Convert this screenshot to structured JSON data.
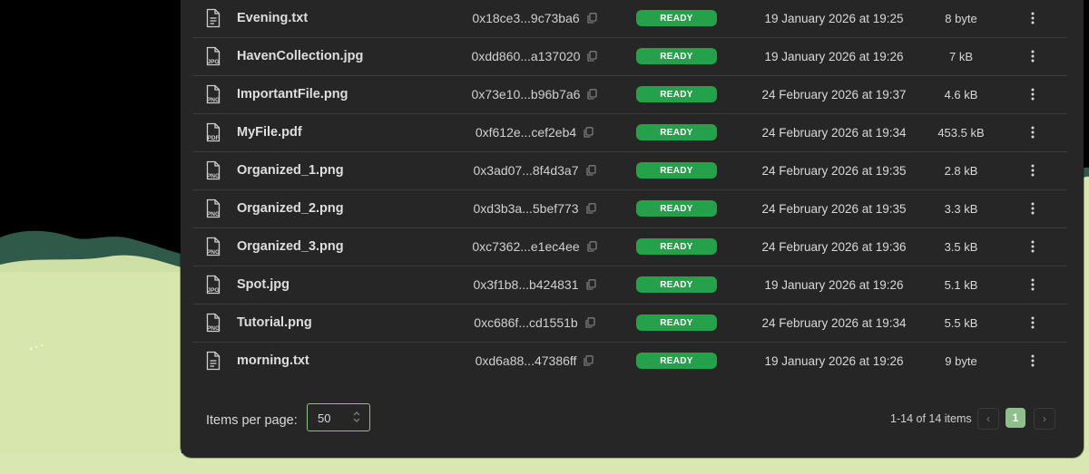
{
  "files": [
    {
      "icon": "txt-file-icon",
      "type_label": "",
      "name": "Evening.txt",
      "hash": "0x18ce3...9c73ba6",
      "status": "READY",
      "date": "19 January 2026 at 19:25",
      "size": "8 byte"
    },
    {
      "icon": "jpg-file-icon",
      "type_label": "JPG",
      "name": "HavenCollection.jpg",
      "hash": "0xdd860...a137020",
      "status": "READY",
      "date": "19 January 2026 at 19:26",
      "size": "7 kB"
    },
    {
      "icon": "png-file-icon",
      "type_label": "PNG",
      "name": "ImportantFile.png",
      "hash": "0x73e10...b96b7a6",
      "status": "READY",
      "date": "24 February 2026 at 19:37",
      "size": "4.6 kB"
    },
    {
      "icon": "pdf-file-icon",
      "type_label": "PDF",
      "name": "MyFile.pdf",
      "hash": "0xf612e...cef2eb4",
      "status": "READY",
      "date": "24 February 2026 at 19:34",
      "size": "453.5 kB"
    },
    {
      "icon": "png-file-icon",
      "type_label": "PNG",
      "name": "Organized_1.png",
      "hash": "0x3ad07...8f4d3a7",
      "status": "READY",
      "date": "24 February 2026 at 19:35",
      "size": "2.8 kB"
    },
    {
      "icon": "png-file-icon",
      "type_label": "PNG",
      "name": "Organized_2.png",
      "hash": "0xd3b3a...5bef773",
      "status": "READY",
      "date": "24 February 2026 at 19:35",
      "size": "3.3 kB"
    },
    {
      "icon": "png-file-icon",
      "type_label": "PNG",
      "name": "Organized_3.png",
      "hash": "0xc7362...e1ec4ee",
      "status": "READY",
      "date": "24 February 2026 at 19:36",
      "size": "3.5 kB"
    },
    {
      "icon": "jpg-file-icon",
      "type_label": "JPG",
      "name": "Spot.jpg",
      "hash": "0x3f1b8...b424831",
      "status": "READY",
      "date": "19 January 2026 at 19:26",
      "size": "5.1 kB"
    },
    {
      "icon": "png-file-icon",
      "type_label": "PNG",
      "name": "Tutorial.png",
      "hash": "0xc686f...cd1551b",
      "status": "READY",
      "date": "24 February 2026 at 19:34",
      "size": "5.5 kB"
    },
    {
      "icon": "txt-file-icon",
      "type_label": "",
      "name": "morning.txt",
      "hash": "0xd6a88...47386ff",
      "status": "READY",
      "date": "19 January 2026 at 19:26",
      "size": "9 byte"
    }
  ],
  "pagination": {
    "items_per_page_label": "Items per page:",
    "items_per_page_value": "50",
    "range_text": "1-14 of 14 items",
    "current_page": "1",
    "prev_symbol": "‹",
    "next_symbol": "›"
  },
  "colors": {
    "panel_bg": "#262626",
    "status_ready": "#24a14a",
    "accent_green": "#8fbf8a"
  }
}
